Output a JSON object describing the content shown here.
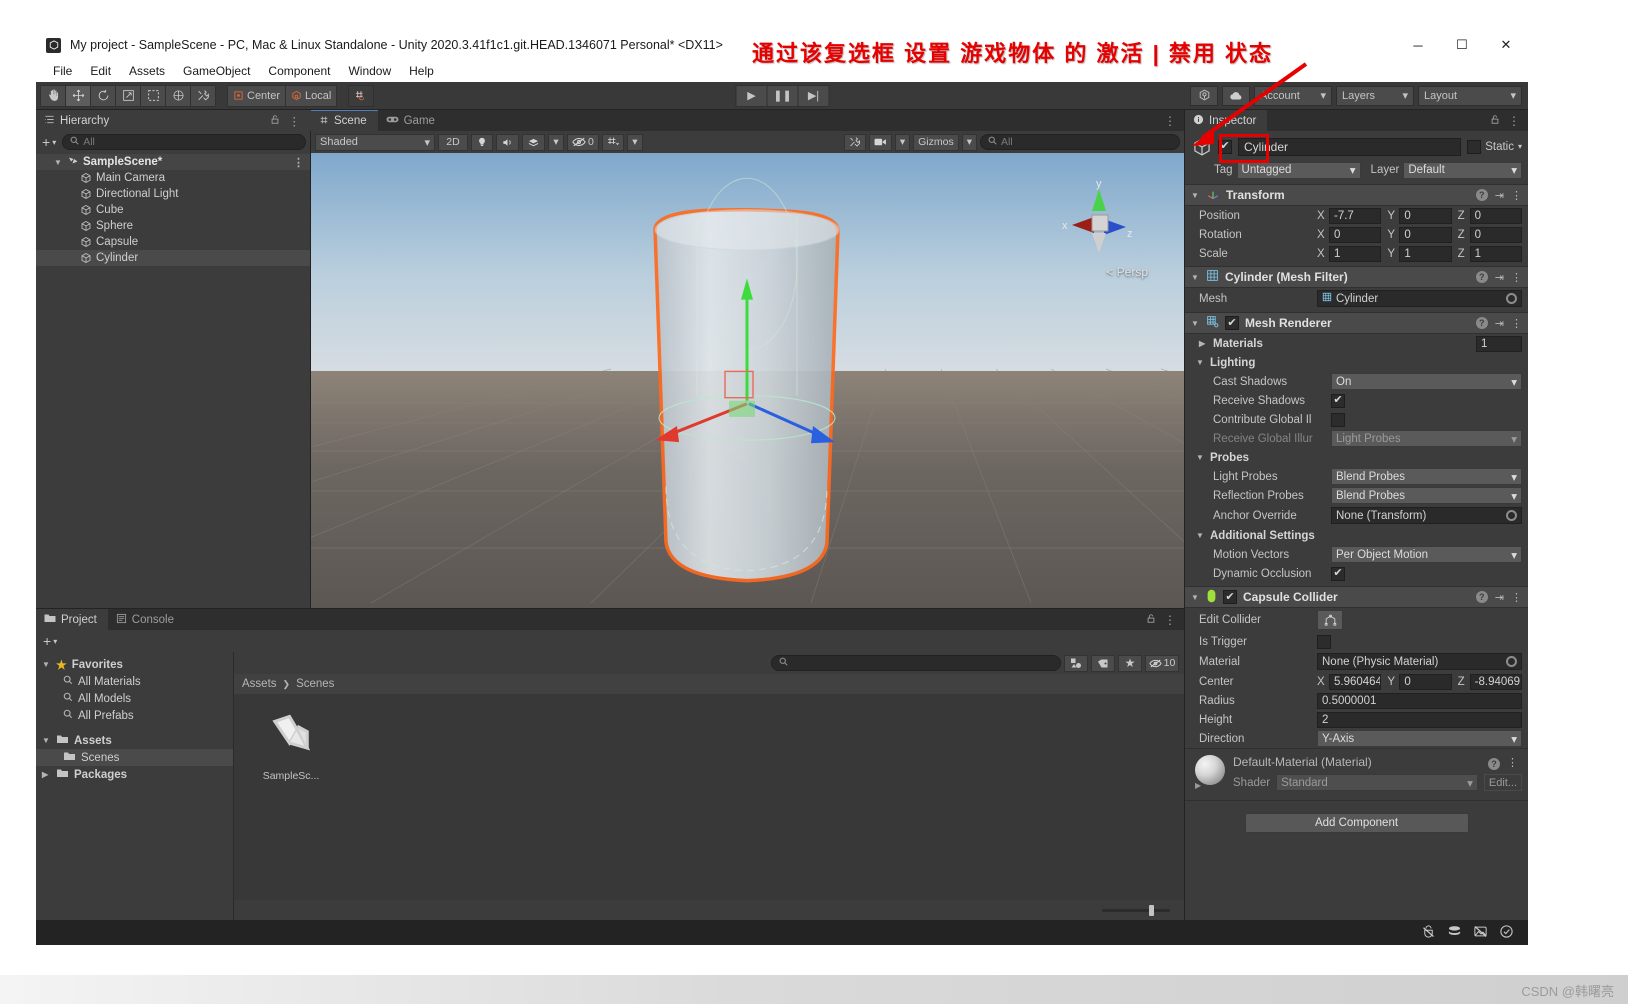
{
  "window": {
    "title": "My project - SampleScene - PC, Mac & Linux Standalone - Unity 2020.3.41f1c1.git.HEAD.1346071 Personal* <DX11>",
    "minimize": "─",
    "maximize": "☐",
    "close": "✕"
  },
  "menubar": {
    "items": [
      "File",
      "Edit",
      "Assets",
      "GameObject",
      "Component",
      "Window",
      "Help"
    ]
  },
  "toolbar": {
    "tools": [
      {
        "name": "hand-tool",
        "glyph": "✋"
      },
      {
        "name": "move-tool",
        "glyph": "✥"
      },
      {
        "name": "rotate-tool",
        "glyph": "↻"
      },
      {
        "name": "scale-tool",
        "glyph": "↗"
      },
      {
        "name": "rect-tool",
        "glyph": "▣"
      },
      {
        "name": "transform-tool",
        "glyph": "☸"
      },
      {
        "name": "custom-tool",
        "glyph": "⚒"
      }
    ],
    "pivot_label": "Center",
    "rotation_label": "Local",
    "grid_snap_label": "#",
    "play": "▶",
    "pause": "❚❚",
    "step": "▶|",
    "collab_icon": "collab-icon",
    "cloud_icon": "cloud-icon",
    "account_label": "Account",
    "layers_label": "Layers",
    "layout_label": "Layout"
  },
  "hierarchy": {
    "tab": "Hierarchy",
    "search_placeholder": "All",
    "lock_icon": "lock-icon",
    "menu_icon": "kebab-icon",
    "scene_name": "SampleScene*",
    "items": [
      {
        "label": "Main Camera",
        "selected": false
      },
      {
        "label": "Directional Light",
        "selected": false
      },
      {
        "label": "Cube",
        "selected": false
      },
      {
        "label": "Sphere",
        "selected": false
      },
      {
        "label": "Capsule",
        "selected": false
      },
      {
        "label": "Cylinder",
        "selected": true
      }
    ]
  },
  "scene": {
    "tabs": [
      {
        "label": "Scene",
        "icon": "grid-icon",
        "active": true
      },
      {
        "label": "Game",
        "icon": "gamepad-icon",
        "active": false
      }
    ],
    "draw_mode": "Shaded",
    "two_d_label": "2D",
    "light_icon": "lightbulb-icon",
    "audio_icon": "speaker-icon",
    "fx_icon": "effects-icon",
    "hidden_count": "0",
    "grid_icon": "grid-visibility-icon",
    "tools_icon": "wrench-icon",
    "camera_icon": "camera-icon",
    "gizmos_label": "Gizmos",
    "search_placeholder": "All",
    "projection_label": "Persp",
    "axis_x": "x",
    "axis_y": "y",
    "axis_z": "z"
  },
  "project": {
    "tabs": [
      {
        "label": "Project",
        "icon": "folder-icon",
        "active": true
      },
      {
        "label": "Console",
        "icon": "console-icon",
        "active": false
      }
    ],
    "lock_icon": "lock-icon",
    "menu_icon": "kebab-icon",
    "search_placeholder": "",
    "hidden_count": "10",
    "tree": [
      {
        "label": "Favorites",
        "level": 0,
        "icon": "star-icon",
        "expanded": true,
        "selected": false
      },
      {
        "label": "All Materials",
        "level": 1,
        "icon": "search-icon",
        "selected": false
      },
      {
        "label": "All Models",
        "level": 1,
        "icon": "search-icon",
        "selected": false
      },
      {
        "label": "All Prefabs",
        "level": 1,
        "icon": "search-icon",
        "selected": false
      },
      {
        "label": "Assets",
        "level": 0,
        "icon": "folder-icon",
        "expanded": true,
        "selected": false
      },
      {
        "label": "Scenes",
        "level": 1,
        "icon": "folder-icon",
        "selected": true
      },
      {
        "label": "Packages",
        "level": 0,
        "icon": "folder-icon",
        "expanded": false,
        "selected": false
      }
    ],
    "breadcrumb": [
      "Assets",
      "Scenes"
    ],
    "assets": [
      {
        "label": "SampleSc...",
        "icon": "unity-scene-icon"
      }
    ]
  },
  "inspector": {
    "tab": "Inspector",
    "lock_icon": "lock-icon",
    "menu_icon": "kebab-icon",
    "object": {
      "enabled": true,
      "name": "Cylinder",
      "static_label": "Static",
      "tag_label": "Tag",
      "tag_value": "Untagged",
      "layer_label": "Layer",
      "layer_value": "Default"
    },
    "transform": {
      "title": "Transform",
      "rows": [
        {
          "label": "Position",
          "x": "-7.7",
          "y": "0",
          "z": "0"
        },
        {
          "label": "Rotation",
          "x": "0",
          "y": "0",
          "z": "0"
        },
        {
          "label": "Scale",
          "x": "1",
          "y": "1",
          "z": "1"
        }
      ]
    },
    "mesh_filter": {
      "title": "Cylinder (Mesh Filter)",
      "mesh_label": "Mesh",
      "mesh_value": "Cylinder"
    },
    "mesh_renderer": {
      "title": "Mesh Renderer",
      "enabled": true,
      "materials_label": "Materials",
      "materials_count": "1",
      "lighting_label": "Lighting",
      "cast_shadows_label": "Cast Shadows",
      "cast_shadows_value": "On",
      "receive_shadows_label": "Receive Shadows",
      "receive_shadows_checked": true,
      "contribute_gi_label": "Contribute Global Il",
      "contribute_gi_checked": false,
      "receive_gi_label": "Receive Global Illur",
      "receive_gi_value": "Light Probes",
      "probes_label": "Probes",
      "light_probes_label": "Light Probes",
      "light_probes_value": "Blend Probes",
      "reflection_probes_label": "Reflection Probes",
      "reflection_probes_value": "Blend Probes",
      "anchor_override_label": "Anchor Override",
      "anchor_override_value": "None (Transform)",
      "additional_settings_label": "Additional Settings",
      "motion_vectors_label": "Motion Vectors",
      "motion_vectors_value": "Per Object Motion",
      "dynamic_occlusion_label": "Dynamic Occlusion",
      "dynamic_occlusion_checked": true
    },
    "capsule_collider": {
      "title": "Capsule Collider",
      "enabled": true,
      "edit_collider_label": "Edit Collider",
      "is_trigger_label": "Is Trigger",
      "is_trigger_checked": false,
      "material_label": "Material",
      "material_value": "None (Physic Material)",
      "center_label": "Center",
      "center_x": "5.960464",
      "center_y": "0",
      "center_z": "-8.94069",
      "radius_label": "Radius",
      "radius_value": "0.5000001",
      "height_label": "Height",
      "height_value": "2",
      "direction_label": "Direction",
      "direction_value": "Y-Axis"
    },
    "material_preview": {
      "title": "Default-Material (Material)",
      "shader_label": "Shader",
      "shader_value": "Standard",
      "edit_label": "Edit..."
    },
    "add_component_label": "Add Component"
  },
  "statusbar": {
    "icons": [
      "no-bug-icon",
      "layers-stack-icon",
      "no-preview-icon",
      "check-circle-icon"
    ]
  },
  "annotation": {
    "text": "通过该复选框 设置 游戏物体 的 激活 | 禁用 状态",
    "color": "#e60000"
  },
  "watermark": {
    "text": "CSDN @韩曙亮"
  }
}
